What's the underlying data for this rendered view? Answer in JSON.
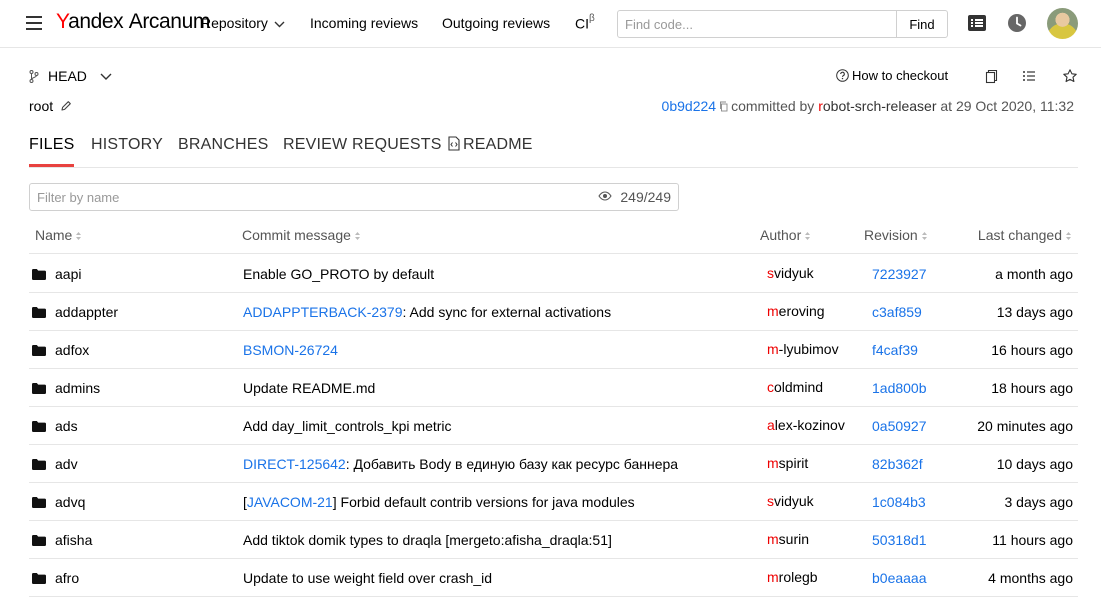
{
  "header": {
    "logo_brand_first": "Y",
    "logo_brand_rest": "andex",
    "logo_product": "Arcanum",
    "nav": {
      "repository": "Repository",
      "incoming": "Incoming reviews",
      "outgoing": "Outgoing reviews",
      "ci": "CI",
      "ci_sup": "β"
    },
    "search": {
      "placeholder": "Find code...",
      "button": "Find"
    }
  },
  "ref": {
    "label": "HEAD"
  },
  "how_to_checkout": "How to checkout",
  "path": {
    "root": "root"
  },
  "commit": {
    "hash": "0b9d224",
    "committed_by": "committed by",
    "author_first": "r",
    "author_rest": "obot-srch-releaser",
    "at": "at 29 Oct 2020, 11:32"
  },
  "tabs": [
    "FILES",
    "HISTORY",
    "BRANCHES",
    "REVIEW REQUESTS",
    "README"
  ],
  "filter": {
    "placeholder": "Filter by name",
    "count": "249/249"
  },
  "columns": {
    "name": "Name",
    "message": "Commit message",
    "author": "Author",
    "revision": "Revision",
    "changed": "Last changed"
  },
  "rows": [
    {
      "name": "aapi",
      "msg_pre": "",
      "msg_link": "",
      "msg_post": "Enable GO_PROTO by default",
      "author_first": "s",
      "author_rest": "vidyuk",
      "rev": "7223927",
      "changed": "a month ago"
    },
    {
      "name": "addappter",
      "msg_pre": "",
      "msg_link": "ADDAPPTERBACK-2379",
      "msg_post": ": Add sync for external activations",
      "author_first": "m",
      "author_rest": "eroving",
      "rev": "c3af859",
      "changed": "13 days ago"
    },
    {
      "name": "adfox",
      "msg_pre": "",
      "msg_link": "BSMON-26724",
      "msg_post": "",
      "author_first": "m",
      "author_rest": "-lyubimov",
      "rev": "f4caf39",
      "changed": "16 hours ago"
    },
    {
      "name": "admins",
      "msg_pre": "",
      "msg_link": "",
      "msg_post": "Update README.md",
      "author_first": "c",
      "author_rest": "oldmind",
      "rev": "1ad800b",
      "changed": "18 hours ago"
    },
    {
      "name": "ads",
      "msg_pre": "",
      "msg_link": "",
      "msg_post": "Add day_limit_controls_kpi metric",
      "author_first": "a",
      "author_rest": "lex-kozinov",
      "rev": "0a50927",
      "changed": "20 minutes ago"
    },
    {
      "name": "adv",
      "msg_pre": "",
      "msg_link": "DIRECT-125642",
      "msg_post": ": Добавить Body в единую базу как ресурс баннера",
      "author_first": "m",
      "author_rest": "spirit",
      "rev": "82b362f",
      "changed": "10 days ago"
    },
    {
      "name": "advq",
      "msg_pre": "[",
      "msg_link": "JAVACOM-21",
      "msg_post": "] Forbid default contrib versions for java modules",
      "author_first": "s",
      "author_rest": "vidyuk",
      "rev": "1c084b3",
      "changed": "3 days ago"
    },
    {
      "name": "afisha",
      "msg_pre": "",
      "msg_link": "",
      "msg_post": "Add tiktok domik types to draqla [mergeto:afisha_draqla:51]",
      "author_first": "m",
      "author_rest": "surin",
      "rev": "50318d1",
      "changed": "11 hours ago"
    },
    {
      "name": "afro",
      "msg_pre": "",
      "msg_link": "",
      "msg_post": "Update to use weight field over crash_id",
      "author_first": "m",
      "author_rest": "rolegb",
      "rev": "b0eaaaa",
      "changed": "4 months ago"
    }
  ],
  "colors": {
    "accent": "#e8423f",
    "link": "#1a73e8",
    "author_first_letter": "#ee0000"
  }
}
